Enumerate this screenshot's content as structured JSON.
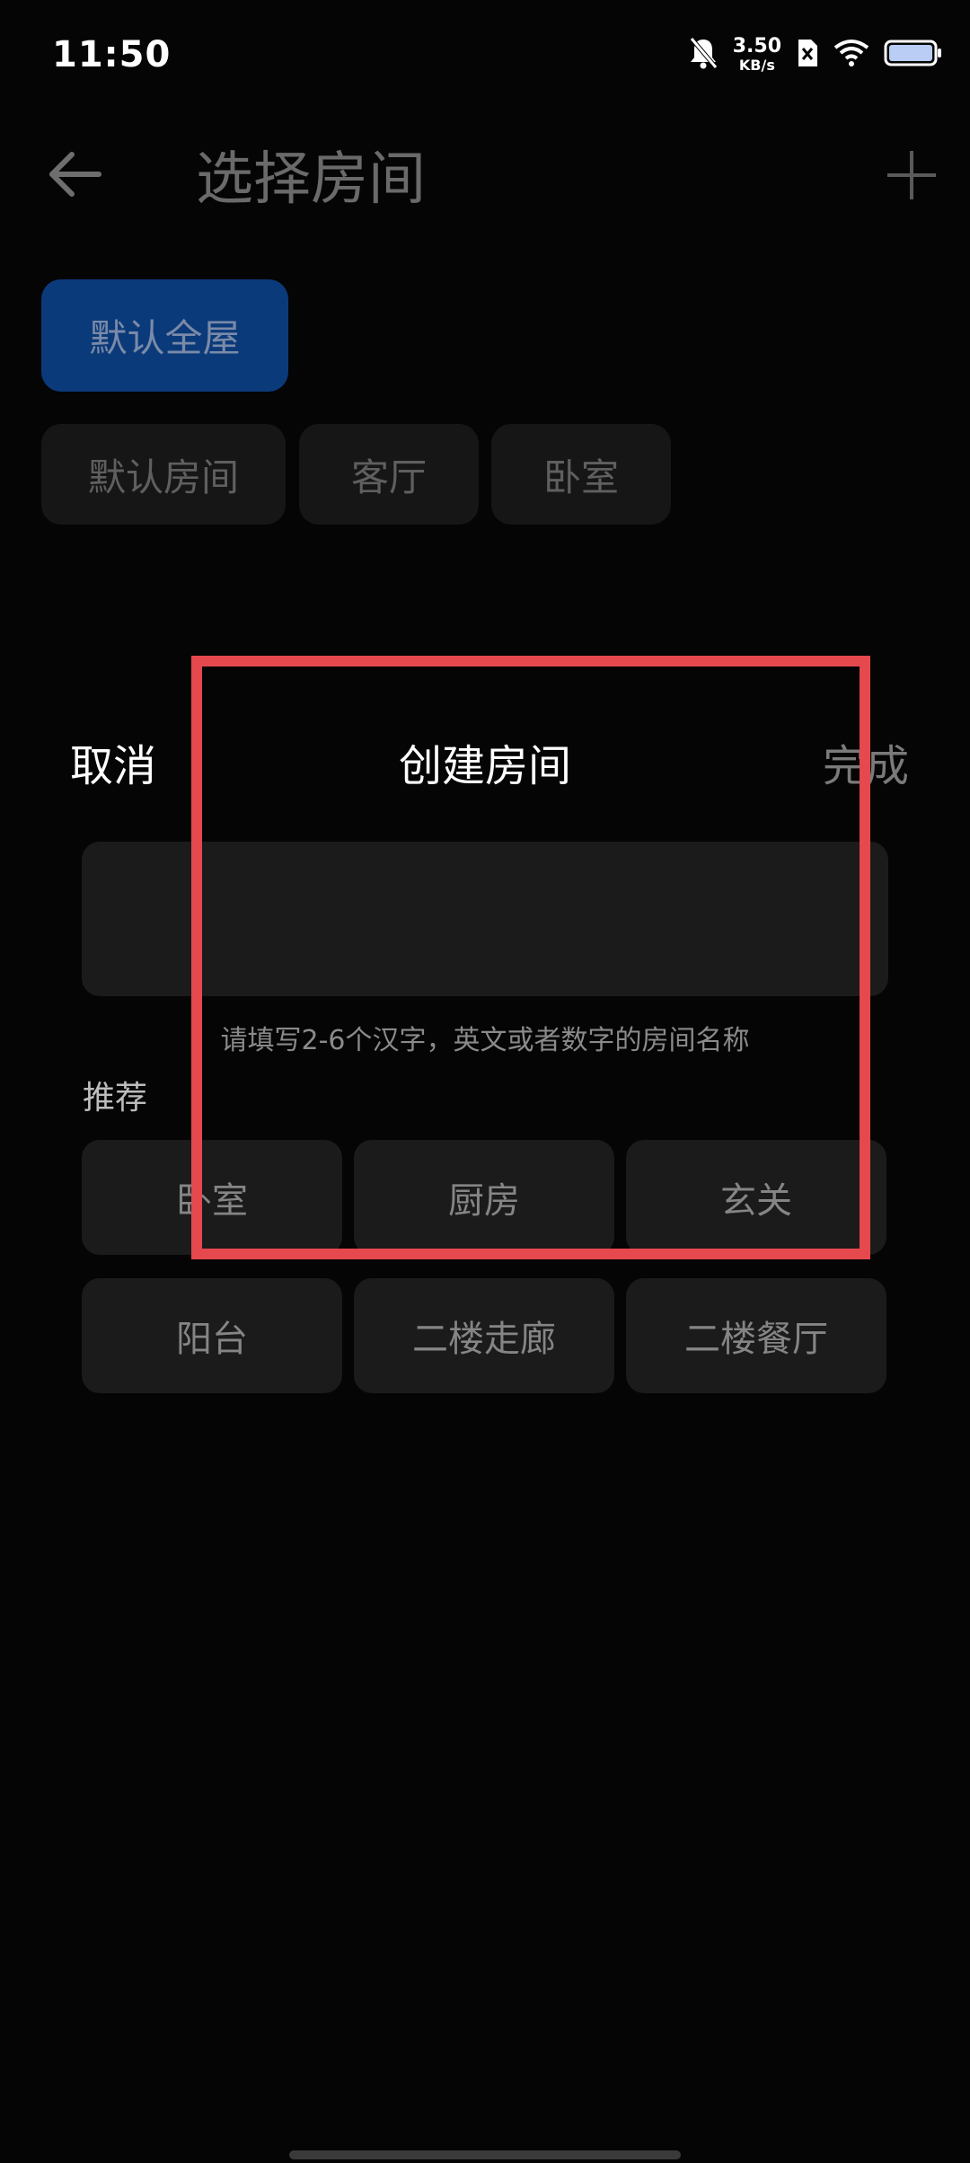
{
  "status_bar": {
    "time": "11:50",
    "net_speed_value": "3.50",
    "net_speed_unit": "KB/s",
    "icons": [
      "mute-bell-icon",
      "sim-blocked-icon",
      "wifi-icon",
      "battery-icon"
    ]
  },
  "header": {
    "title": "选择房间",
    "back_icon": "back-arrow-icon",
    "add_icon": "plus-icon"
  },
  "rooms": {
    "active": "默认全屋",
    "items": [
      "默认房间",
      "客厅",
      "卧室"
    ]
  },
  "sheet": {
    "cancel_label": "取消",
    "title": "创建房间",
    "done_label": "完成",
    "input_value": "",
    "hint": "请填写2-6个汉字，英文或者数字的房间名称",
    "recommend_label": "推荐",
    "recommendations": [
      "卧室",
      "厨房",
      "玄关",
      "阳台",
      "二楼走廊",
      "二楼餐厅"
    ]
  },
  "colors": {
    "background": "#050505",
    "active_chip": "#0b3a7a",
    "highlight": "#e5484d"
  }
}
